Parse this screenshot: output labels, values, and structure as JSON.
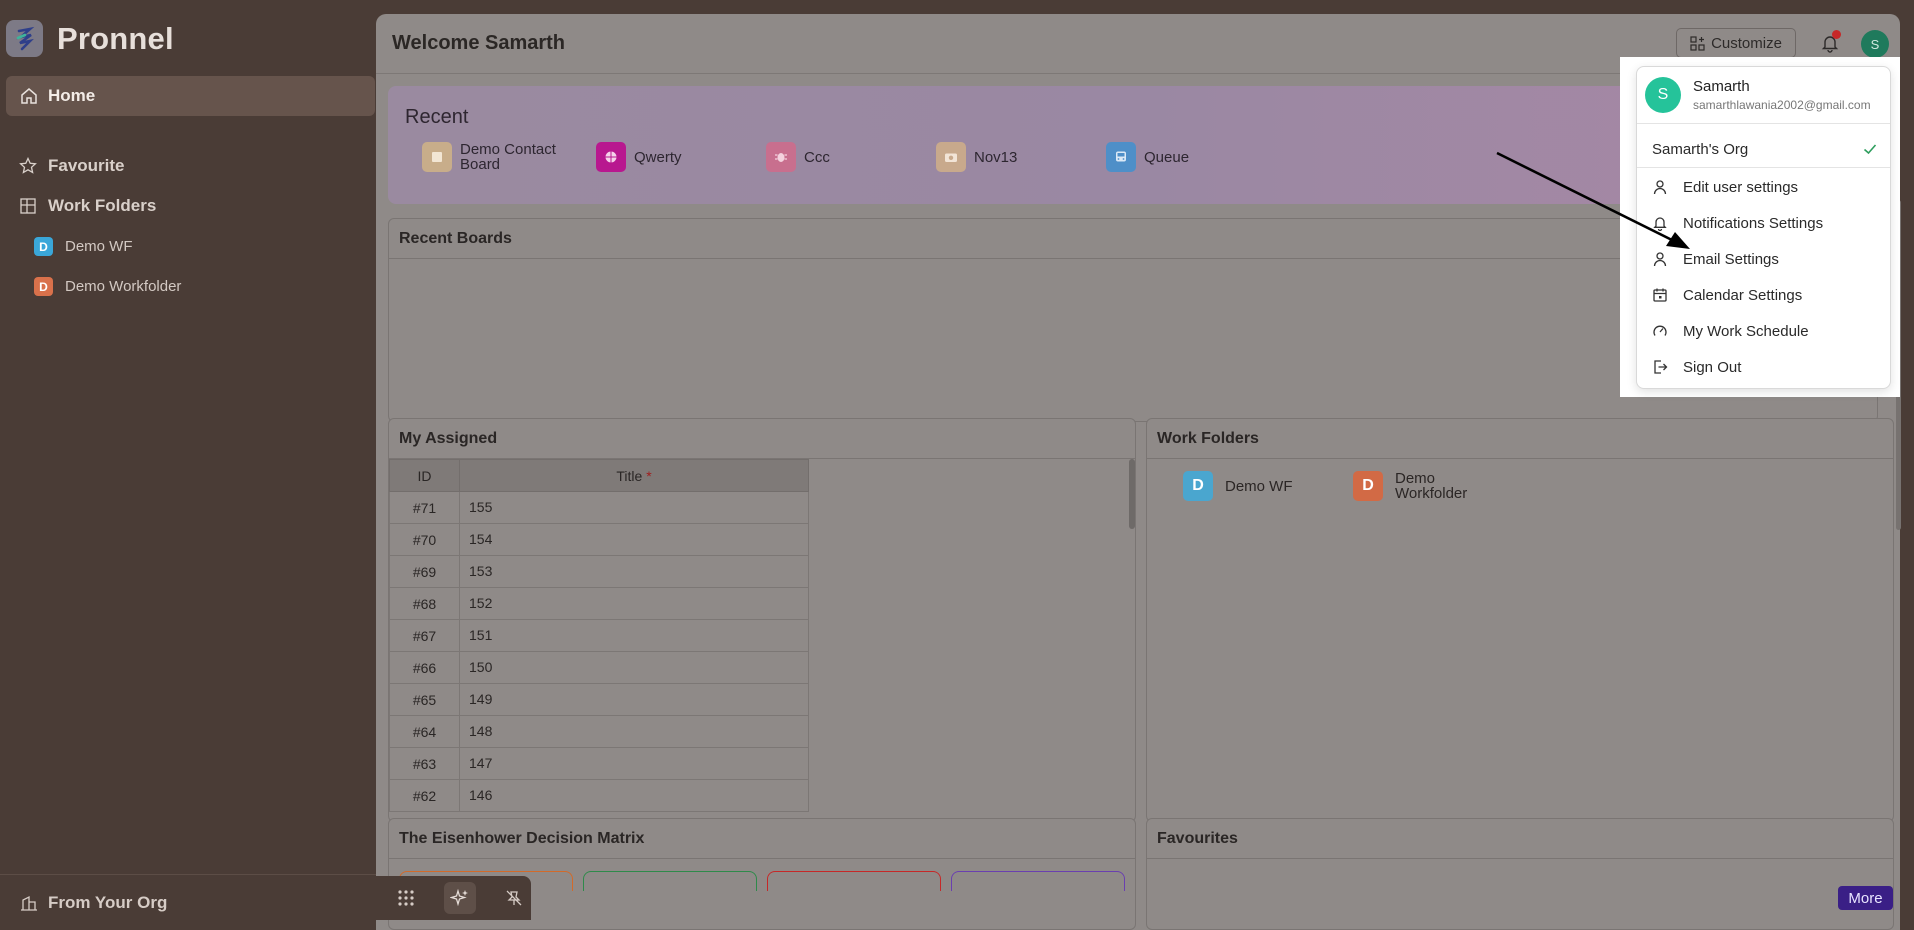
{
  "app": {
    "name": "Pronnel"
  },
  "sidebar": {
    "home_label": "Home",
    "favourite_label": "Favourite",
    "work_folders_label": "Work Folders",
    "folders": [
      {
        "badge": "D",
        "label": "Demo WF",
        "color": "#3aa7d9"
      },
      {
        "badge": "D",
        "label": "Demo Workfolder",
        "color": "#d9714b"
      }
    ],
    "bottom_label": "From Your Org"
  },
  "header": {
    "title": "Welcome Samarth",
    "customize_label": "Customize",
    "avatar_initial": "S"
  },
  "recent": {
    "title": "Recent",
    "items": [
      {
        "label": "Demo Contact Board",
        "icon": "board-icon",
        "color": "#c8ad8a"
      },
      {
        "label": "Qwerty",
        "icon": "globe-icon",
        "color": "#b8188f"
      },
      {
        "label": "Ccc",
        "icon": "bug-icon",
        "color": "#c86f8e"
      },
      {
        "label": "Nov13",
        "icon": "camera-icon",
        "color": "#c8a98c"
      },
      {
        "label": "Queue",
        "icon": "bus-icon",
        "color": "#4e8fc8"
      }
    ]
  },
  "recent_boards": {
    "title": "Recent Boards"
  },
  "my_assigned": {
    "title": "My Assigned",
    "columns": {
      "id": "ID",
      "title": "Title",
      "required_mark": "*"
    },
    "rows": [
      {
        "id": "#71",
        "title": "155"
      },
      {
        "id": "#70",
        "title": "154"
      },
      {
        "id": "#69",
        "title": "153"
      },
      {
        "id": "#68",
        "title": "152"
      },
      {
        "id": "#67",
        "title": "151"
      },
      {
        "id": "#66",
        "title": "150"
      },
      {
        "id": "#65",
        "title": "149"
      },
      {
        "id": "#64",
        "title": "148"
      },
      {
        "id": "#63",
        "title": "147"
      },
      {
        "id": "#62",
        "title": "146"
      }
    ]
  },
  "work_folders_panel": {
    "title": "Work Folders",
    "items": [
      {
        "badge": "D",
        "label": "Demo WF",
        "color": "#4aa6cf"
      },
      {
        "badge": "D",
        "label": "Demo Workfolder",
        "color": "#d26a45"
      }
    ]
  },
  "eisenhower": {
    "title": "The Eisenhower Decision Matrix",
    "box_colors": [
      "#d26a2a",
      "#2e8a4a",
      "#c62828",
      "#6a3fb0"
    ]
  },
  "favourites": {
    "title": "Favourites"
  },
  "dock": {
    "more_label": "More"
  },
  "user_menu": {
    "name": "Samarth",
    "email": "samarthlawania2002@gmail.com",
    "avatar_initial": "S",
    "org": "Samarth's Org",
    "items": [
      {
        "label": "Edit user settings",
        "icon": "user-icon"
      },
      {
        "label": "Notifications Settings",
        "icon": "bell-icon"
      },
      {
        "label": "Email Settings",
        "icon": "user-icon"
      },
      {
        "label": "Calendar Settings",
        "icon": "calendar-icon"
      },
      {
        "label": "My Work Schedule",
        "icon": "gauge-icon"
      },
      {
        "label": "Sign Out",
        "icon": "sign-out-icon"
      }
    ]
  }
}
